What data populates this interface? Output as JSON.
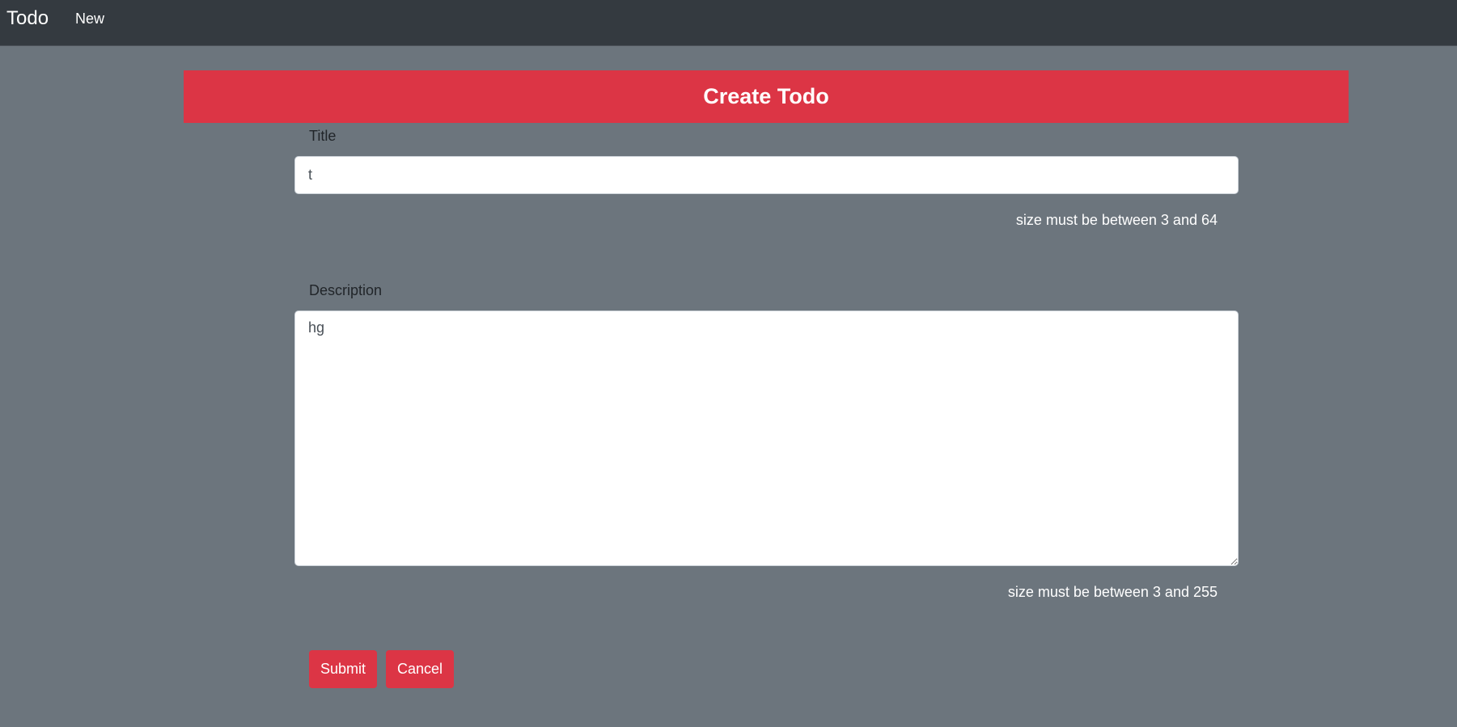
{
  "navbar": {
    "brand": "Todo",
    "links": [
      {
        "label": "New"
      }
    ]
  },
  "form": {
    "heading": "Create Todo",
    "title": {
      "label": "Title",
      "value": "t",
      "error": "size must be between 3 and 64"
    },
    "description": {
      "label": "Description",
      "value": "hg",
      "error": "size must be between 3 and 255"
    },
    "submit_label": "Submit",
    "cancel_label": "Cancel"
  },
  "colors": {
    "accent": "#dc3545",
    "navbar": "#343a40",
    "background": "#6c757d"
  }
}
